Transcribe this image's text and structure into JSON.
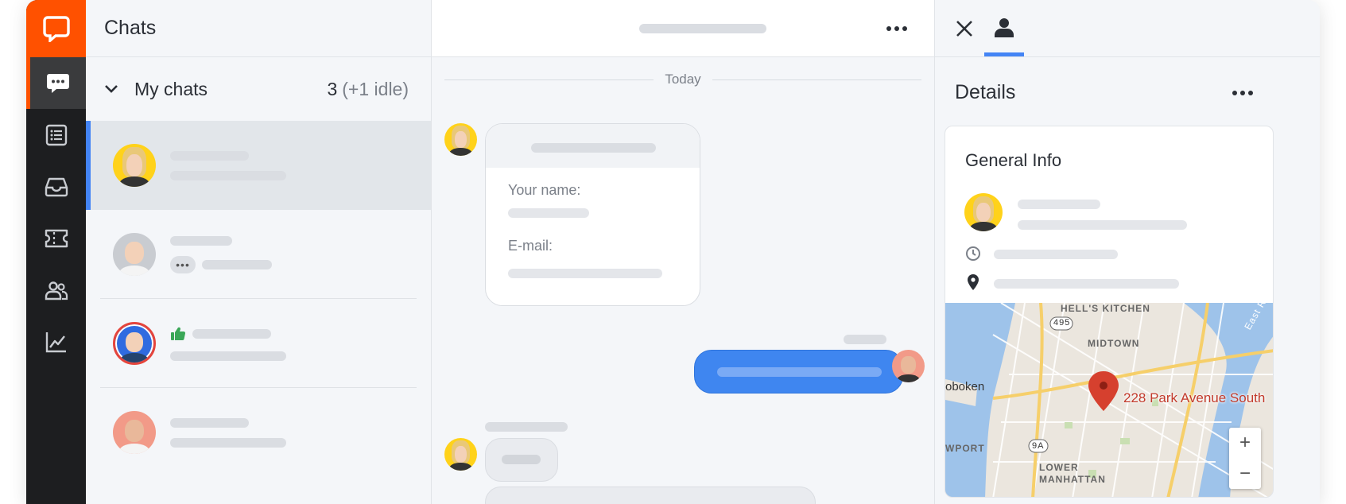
{
  "colors": {
    "brand": "#ff5100",
    "accent": "#4384f5",
    "rail": "#1d1e20",
    "agent_bubble": "#3f86f0",
    "map_pin": "#d6402e",
    "thumbs_up": "#3aa757"
  },
  "rail": {
    "logo_icon": "speech-bubble-logo-icon",
    "items": [
      {
        "icon": "chats-icon",
        "active": true
      },
      {
        "icon": "archives-list-icon",
        "active": false
      },
      {
        "icon": "inbox-icon",
        "active": false
      },
      {
        "icon": "ticket-icon",
        "active": false
      },
      {
        "icon": "customers-icon",
        "active": false
      },
      {
        "icon": "reports-chart-icon",
        "active": false
      }
    ]
  },
  "chat_list": {
    "title": "Chats",
    "section": {
      "label": "My chats",
      "count": "3",
      "idle": "(+1 idle)"
    },
    "rows": [
      {
        "avatar": "blonde-woman",
        "selected": true,
        "typing": false,
        "thumbs_up": false
      },
      {
        "avatar": "man-glasses",
        "selected": false,
        "typing": true,
        "thumbs_up": false
      },
      {
        "avatar": "man-glasses-blue",
        "selected": false,
        "typing": false,
        "thumbs_up": true
      },
      {
        "avatar": "bald-bearded-man",
        "selected": false,
        "typing": false,
        "thumbs_up": false
      }
    ]
  },
  "conversation": {
    "date_divider": "Today",
    "form": {
      "name_label": "Your name:",
      "email_label": "E-mail:"
    }
  },
  "details": {
    "title": "Details",
    "card_title": "General Info",
    "map": {
      "address": "228 Park Avenue South",
      "labels": {
        "hells_kitchen": "HELL'S KITCHEN",
        "midtown": "MIDTOWN",
        "hoboken": "oboken",
        "newport": "WPORT",
        "lower_manhattan": "LOWER MANHATTAN",
        "route_495": "495",
        "route_9a": "9A",
        "east_river": "East Ri"
      },
      "zoom_in": "+",
      "zoom_out": "−"
    }
  }
}
